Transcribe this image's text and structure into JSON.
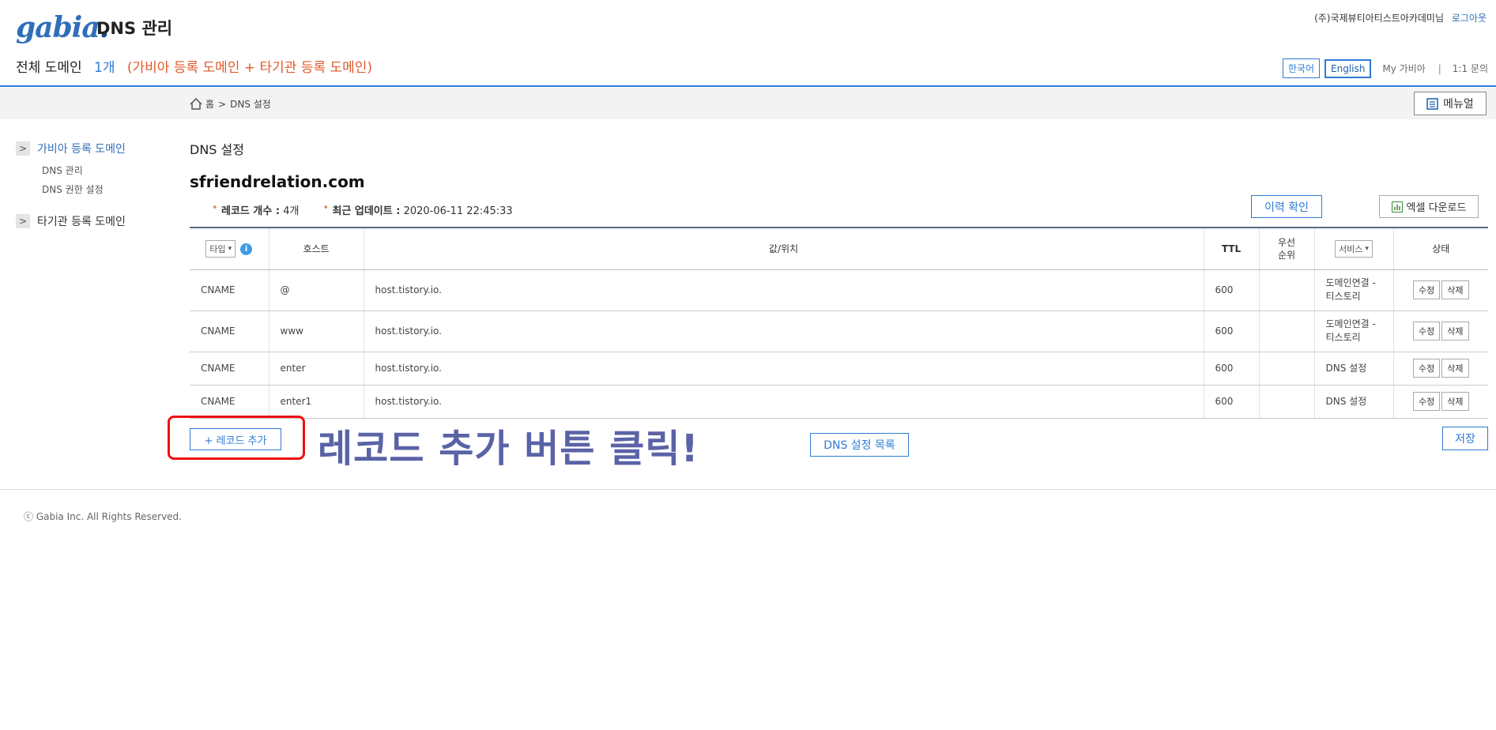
{
  "header": {
    "logo": "gabia",
    "logo_dot": ".",
    "app_title": "DNS 관리",
    "user_name": "(주)국제뷰티아티스트아카데미님",
    "logout": "로그아웃",
    "domain_label": "전체 도메인",
    "domain_count": "1개",
    "domain_detail": "(가비아 등록 도메인 + 타기관 등록 도메인)",
    "lang_ko": "한국어",
    "lang_en": "English",
    "my_gabia": "My 가비아",
    "separator": "|",
    "inquiry": "1:1 문의"
  },
  "breadcrumb": {
    "home": "홈",
    "sep": ">",
    "current": "DNS 설정"
  },
  "menu_button": "메뉴얼",
  "sidebar": {
    "group1": {
      "label": "가비아 등록 도메인",
      "chevron": ">"
    },
    "sub_items": [
      "DNS 관리",
      "DNS 권한 설정"
    ],
    "group2": {
      "label": "타기관 등록 도메인",
      "chevron": ">"
    }
  },
  "main": {
    "title": "DNS 설정",
    "domain": "sfriendrelation.com",
    "record_count_label": "레코드 개수 :",
    "record_count": "4개",
    "last_update_label": "최근 업데이트 :",
    "last_update": "2020-06-11 22:45:33",
    "history_button": "이력 확인",
    "excel_button": "엑셀 다운로드"
  },
  "table": {
    "headers": {
      "type": "타입",
      "type_arrow": "▾",
      "info": "i",
      "host": "호스트",
      "value": "값/위치",
      "ttl": "TTL",
      "priority_1": "우선",
      "priority_2": "순위",
      "service": "서비스",
      "service_arrow": "▾",
      "status": "상태"
    },
    "edit_label": "수정",
    "delete_label": "삭제",
    "rows": [
      {
        "type": "CNAME",
        "host": "@",
        "value": "host.tistory.io.",
        "ttl": "600",
        "priority": "",
        "service_1": "도메인연결 -",
        "service_2": "티스토리"
      },
      {
        "type": "CNAME",
        "host": "www",
        "value": "host.tistory.io.",
        "ttl": "600",
        "priority": "",
        "service_1": "도메인연결 -",
        "service_2": "티스토리"
      },
      {
        "type": "CNAME",
        "host": "enter",
        "value": "host.tistory.io.",
        "ttl": "600",
        "priority": "",
        "service_1": "DNS 설정",
        "service_2": ""
      },
      {
        "type": "CNAME",
        "host": "enter1",
        "value": "host.tistory.io.",
        "ttl": "600",
        "priority": "",
        "service_1": "DNS 설정",
        "service_2": ""
      }
    ]
  },
  "actions": {
    "add_record": "+ 레코드 추가",
    "annotation": "레코드 추가 버튼 클릭!",
    "dns_list": "DNS 설정 목록",
    "save": "저장"
  },
  "footer": {
    "copyright": "ⓒ Gabia Inc. All Rights Reserved."
  },
  "colors": {
    "accent": "#2f7bd6",
    "orange": "#e05a2b",
    "annotation": "#5a63a6",
    "highlight_box": "#ee1010"
  }
}
